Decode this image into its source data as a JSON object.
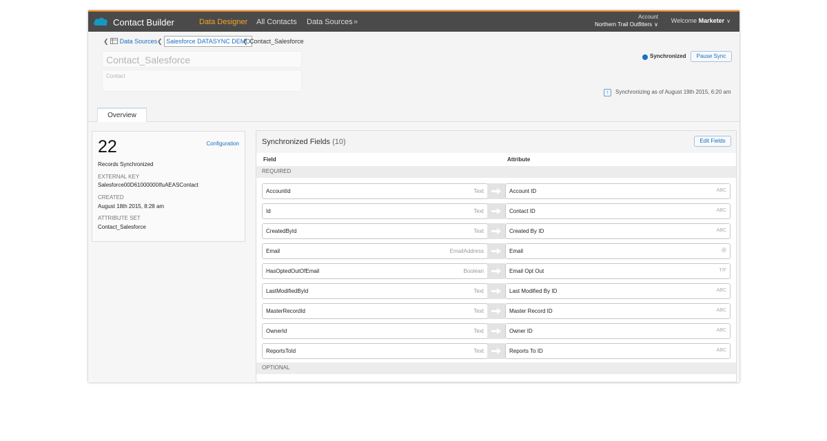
{
  "topbar": {
    "app_title": "Contact Builder",
    "nav": [
      "Data Designer",
      "All Contacts",
      "Data Sources"
    ],
    "more": "»",
    "account_label": "Account",
    "account_value": "Northern Trail Outfitters",
    "welcome_text": "Welcome",
    "welcome_user": "Marketer",
    "logo_color": "#1798c1",
    "accent": "#e8871e"
  },
  "breadcrumb": [
    "Data Sources",
    "Salesforce DATASYNC DEMO",
    "Contact_Salesforce"
  ],
  "header": {
    "name_placeholder": "Contact_Salesforce",
    "desc_placeholder": "Contact",
    "sync_status": "Synchronized",
    "pause_button": "Pause Sync",
    "sync_time": "Synchronizing as of August 19th 2015, 6:20 am"
  },
  "tabs": [
    "Overview"
  ],
  "summary": {
    "count": "22",
    "count_label": "Records Synchronized",
    "config_link": "Configuration",
    "external_key_label": "EXTERNAL KEY",
    "external_key": "Salesforce00D61000000IfuAEASContact",
    "created_label": "CREATED",
    "created": "August 18th 2015, 8:28 am",
    "attribute_set_label": "ATTRIBUTE SET",
    "attribute_set": "Contact_Salesforce"
  },
  "fields_panel": {
    "title": "Synchronized Fields",
    "count": "(10)",
    "edit_button": "Edit Fields",
    "col_field": "Field",
    "col_attribute": "Attribute",
    "section_required": "REQUIRED",
    "section_optional": "OPTIONAL",
    "rows": [
      {
        "field": "AccountId",
        "type": "Text",
        "attribute": "Account ID",
        "icon": "ABC"
      },
      {
        "field": "Id",
        "type": "Text",
        "attribute": "Contact ID",
        "icon": "ABC"
      },
      {
        "field": "CreatedById",
        "type": "Text",
        "attribute": "Created By ID",
        "icon": "ABC"
      },
      {
        "field": "Email",
        "type": "EmailAddress",
        "attribute": "Email",
        "icon": "@"
      },
      {
        "field": "HasOptedOutOfEmail",
        "type": "Boolean",
        "attribute": "Email Opt Out",
        "icon": "T/F"
      },
      {
        "field": "LastModifiedById",
        "type": "Text",
        "attribute": "Last Modified By ID",
        "icon": "ABC"
      },
      {
        "field": "MasterRecordId",
        "type": "Text",
        "attribute": "Master Record ID",
        "icon": "ABC"
      },
      {
        "field": "OwnerId",
        "type": "Text",
        "attribute": "Owner ID",
        "icon": "ABC"
      },
      {
        "field": "ReportsToId",
        "type": "Text",
        "attribute": "Reports To ID",
        "icon": "ABC"
      }
    ]
  }
}
